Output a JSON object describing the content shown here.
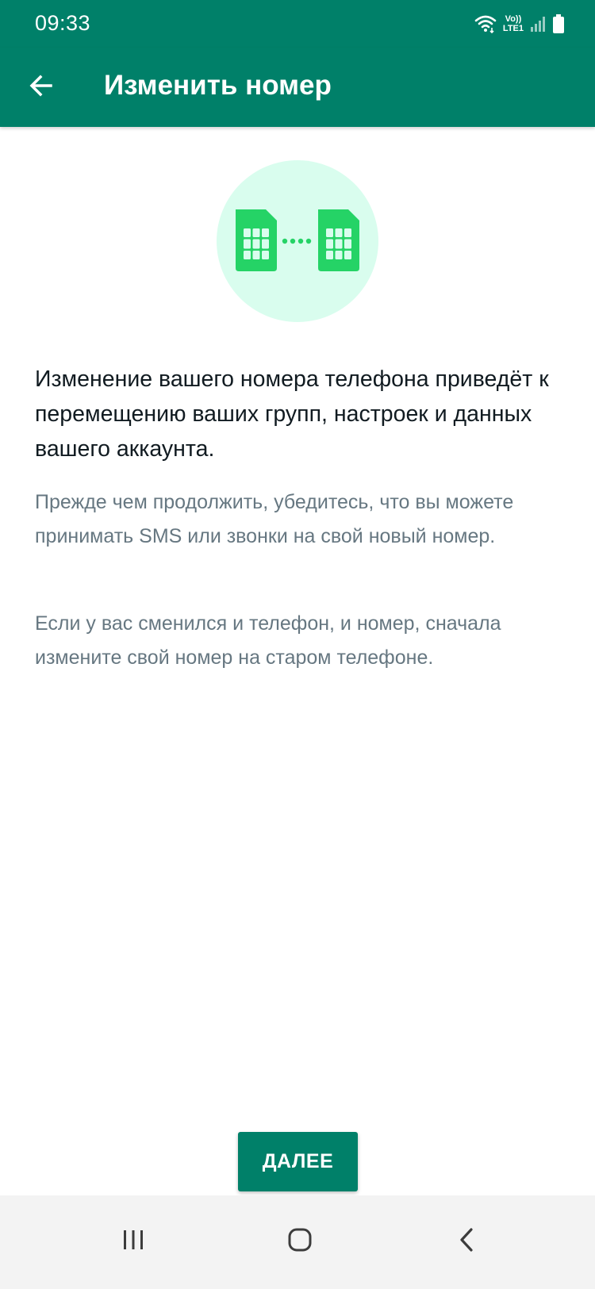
{
  "status_bar": {
    "time": "09:33",
    "network_top": "Vo))",
    "network_bottom": "LTE1",
    "icons": [
      "wifi-icon",
      "signal-icon",
      "battery-icon"
    ]
  },
  "app_bar": {
    "title": "Изменить номер",
    "back_icon": "arrow-left-icon"
  },
  "illustration": {
    "icons": [
      "sim-card-icon",
      "dots-icon",
      "sim-card-icon"
    ]
  },
  "content": {
    "headline": "Изменение вашего номера телефона приведёт к перемещению ваших групп, настроек и данных вашего аккаунта.",
    "paragraph_1": "Прежде чем продолжить, убедитесь, что вы можете принимать SMS или звонки на свой новый номер.",
    "paragraph_2": "Если у вас сменился и телефон, и номер, сначала измените свой номер на старом телефоне."
  },
  "actions": {
    "next_label": "ДАЛЕЕ"
  },
  "nav_bar": {
    "icons": [
      "recent-apps-icon",
      "home-icon",
      "back-icon"
    ]
  },
  "colors": {
    "primary": "#008069",
    "illustration_bg": "#d9fdee",
    "sim_green": "#25d366",
    "text_primary": "#111b21",
    "text_secondary": "#667781"
  }
}
